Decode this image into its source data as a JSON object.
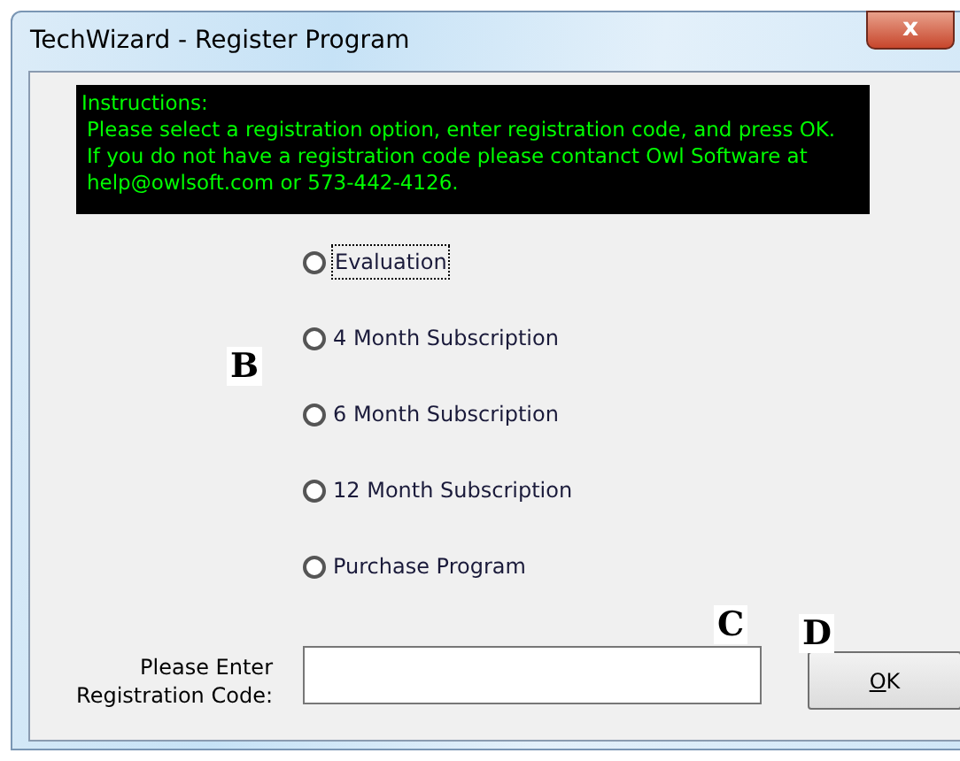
{
  "window": {
    "title": "TechWizard - Register Program",
    "close_glyph": "x"
  },
  "instructions": {
    "heading": "Instructions:",
    "lines": [
      "Please select a registration option, enter registration code, and press OK.",
      "If you do not have a registration code please contanct Owl Software at",
      "help@owlsoft.com or 573-442-4126."
    ]
  },
  "options": [
    {
      "label": "Evaluation",
      "selected": false,
      "focused": true
    },
    {
      "label": "4 Month Subscription",
      "selected": false,
      "focused": false
    },
    {
      "label": "6 Month Subscription",
      "selected": false,
      "focused": false
    },
    {
      "label": "12 Month Subscription",
      "selected": false,
      "focused": false
    },
    {
      "label": "Purchase Program",
      "selected": false,
      "focused": false
    }
  ],
  "code_label": [
    "Please Enter",
    "Registration Code:"
  ],
  "ok_button": {
    "label": "OK",
    "access_key_underlined": true
  },
  "callouts": [
    "B",
    "C",
    "D"
  ]
}
